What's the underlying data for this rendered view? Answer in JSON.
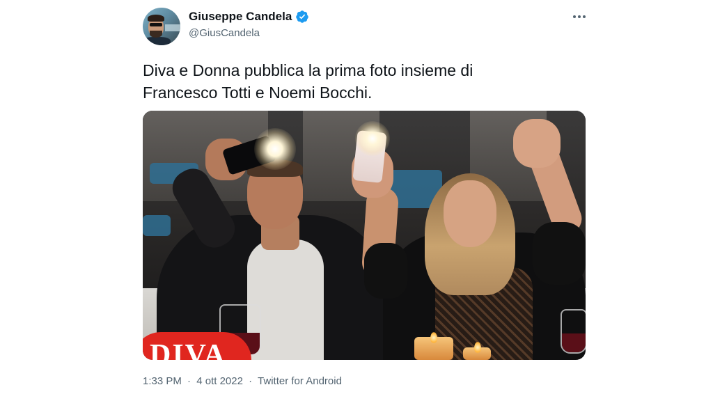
{
  "author": {
    "display_name": "Giuseppe Candela",
    "handle": "@GiusCandela",
    "verified": true
  },
  "tweet": {
    "text_lines": [
      "Diva e Donna pubblica la prima foto insieme di",
      "Francesco Totti e Noemi Bocchi."
    ]
  },
  "media": {
    "watermark": "DIVA"
  },
  "meta": {
    "time": "1:33 PM",
    "date": "4 ott 2022",
    "source": "Twitter for Android",
    "separator": "·"
  },
  "icons": {
    "verified": "verified-badge-icon",
    "more": "more-horizontal-icon"
  },
  "colors": {
    "verified_blue": "#1d9bf0",
    "text_primary": "#0f1419",
    "text_secondary": "#536471",
    "diva_red": "#e0261f"
  }
}
